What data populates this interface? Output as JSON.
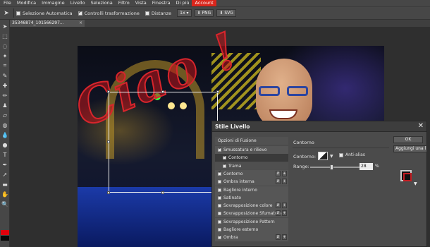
{
  "menubar": {
    "items": [
      "File",
      "Modifica",
      "Immagine",
      "Livello",
      "Seleziona",
      "Filtro",
      "Vista",
      "Finestra",
      "Di più",
      "Account"
    ]
  },
  "options": {
    "auto_select": "Selezione Automatica",
    "transform_controls": "Controlli trasformazione",
    "distances": "Distanze",
    "zoom": "1x",
    "png": "PNG",
    "svg": "SVG"
  },
  "tab": {
    "label": "35346874_101566297...",
    "close": "×"
  },
  "canvas": {
    "text": "Ciao !"
  },
  "dialog": {
    "title": "Stile Livello",
    "close": "✕",
    "options_header": "Opzioni di Fusione",
    "effects": [
      {
        "label": "Smussatura e rilievo",
        "checked": true,
        "indent": false,
        "pm": false
      },
      {
        "label": "Contorno",
        "checked": true,
        "indent": true,
        "pm": false,
        "selected": true
      },
      {
        "label": "Trama",
        "checked": true,
        "indent": true,
        "pm": false
      },
      {
        "label": "Contorno",
        "checked": true,
        "indent": false,
        "pm": true
      },
      {
        "label": "Ombra interna",
        "checked": false,
        "indent": false,
        "pm": true
      },
      {
        "label": "Bagliore interno",
        "checked": false,
        "indent": false,
        "pm": false
      },
      {
        "label": "Satinato",
        "checked": true,
        "indent": false,
        "pm": false
      },
      {
        "label": "Sovrapposizione colore",
        "checked": false,
        "indent": false,
        "pm": true
      },
      {
        "label": "Sovrapposizione Sfumatura",
        "checked": false,
        "indent": false,
        "pm": true
      },
      {
        "label": "Sovrapposizione Pattern",
        "checked": false,
        "indent": false,
        "pm": false
      },
      {
        "label": "Bagliore esterno",
        "checked": false,
        "indent": false,
        "pm": false
      },
      {
        "label": "Ombra",
        "checked": true,
        "indent": false,
        "pm": true
      }
    ],
    "section_title": "Contorno",
    "contour_label": "Contorno:",
    "anti_alias": "Anti-alias",
    "range_label": "Range:",
    "range_value": "28",
    "range_unit": "%",
    "range_fraction": 0.28,
    "ok": "OK",
    "add_style": "Aggiungi una l"
  },
  "colors": {
    "foreground": "#e0000c",
    "background": "#080808",
    "account_highlight": "#d9261c"
  },
  "icons": [
    "move-icon",
    "marquee-icon",
    "lasso-icon",
    "magic-wand-icon",
    "crop-icon",
    "eyedropper-icon",
    "healing-icon",
    "brush-icon",
    "clone-stamp-icon",
    "eraser-icon",
    "fill-icon",
    "blur-icon",
    "dodge-icon",
    "pen-icon",
    "type-icon",
    "path-select-icon",
    "shape-icon",
    "hand-icon",
    "zoom-icon"
  ]
}
